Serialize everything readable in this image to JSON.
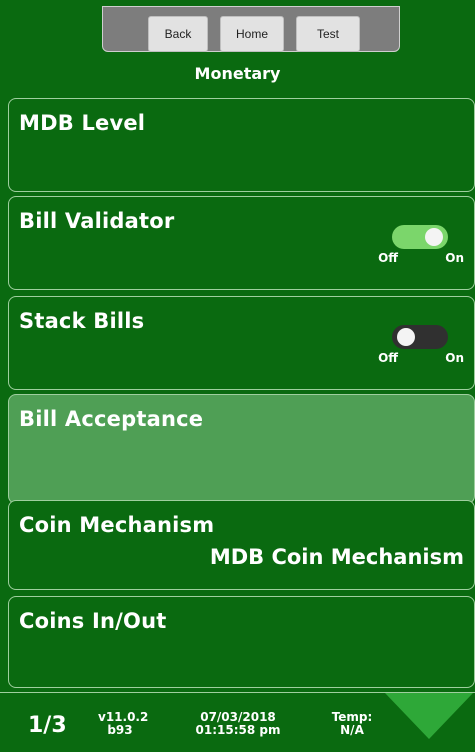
{
  "nav": {
    "back": "Back",
    "home": "Home",
    "test": "Test"
  },
  "page_title": "Monetary",
  "rows": [
    {
      "label": "MDB Level"
    },
    {
      "label": "Bill Validator",
      "toggle": "on",
      "off_label": "Off",
      "on_label": "On"
    },
    {
      "label": "Stack Bills",
      "toggle": "off",
      "off_label": "Off",
      "on_label": "On"
    },
    {
      "label": "Bill Acceptance",
      "selected": true
    },
    {
      "label": "Coin Mechanism",
      "value": "MDB Coin Mechanism"
    },
    {
      "label": "Coins In/Out"
    }
  ],
  "footer": {
    "page": "1/3",
    "version_line1": "v11.0.2",
    "version_line2": "b93",
    "date": "07/03/2018",
    "time": "01:15:58 pm",
    "temp_label": "Temp:",
    "temp_value": "N/A"
  },
  "colors": {
    "background": "#0a6a10",
    "toggle_on": "#7bd66b",
    "toggle_off": "#303030",
    "selected_row": "#4f9f55",
    "arrow": "#2ea838"
  }
}
